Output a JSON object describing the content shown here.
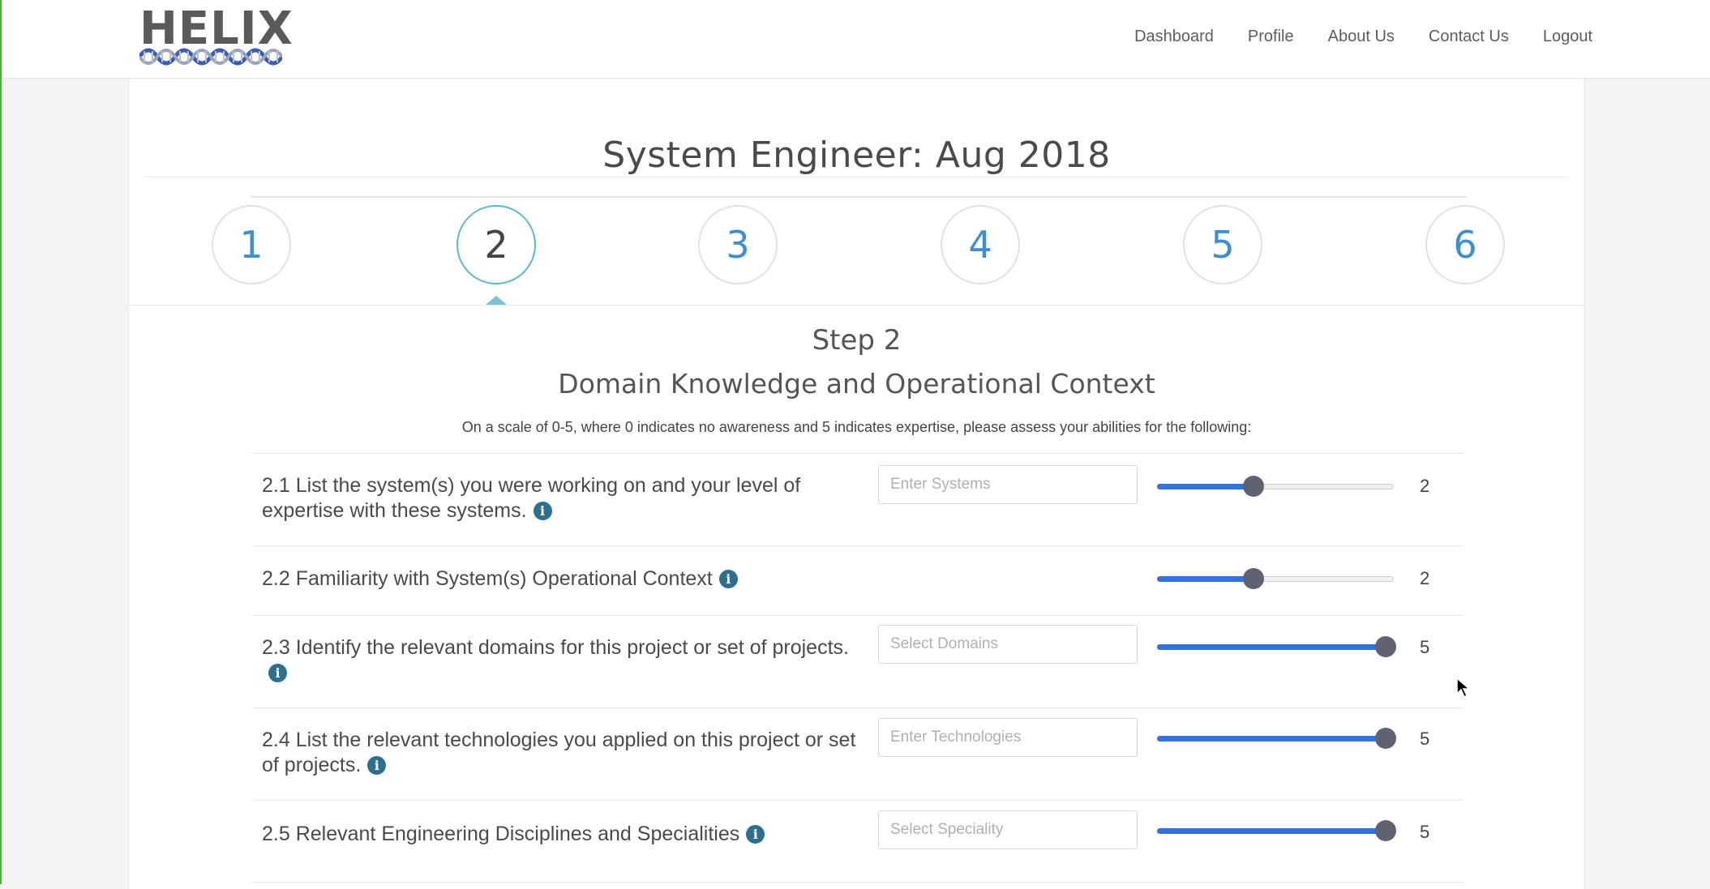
{
  "brand": {
    "logo_text": "HELIX"
  },
  "nav": {
    "items": [
      "Dashboard",
      "Profile",
      "About Us",
      "Contact Us",
      "Logout"
    ]
  },
  "page": {
    "title": "System Engineer: Aug 2018"
  },
  "stepper": {
    "steps": [
      "1",
      "2",
      "3",
      "4",
      "5",
      "6"
    ],
    "active_step": "2"
  },
  "step": {
    "label": "Step 2",
    "subtitle": "Domain Knowledge and Operational Context",
    "instructions": "On a scale of 0-5, where 0 indicates no awareness and 5 indicates expertise, please assess your abilities for the following:"
  },
  "questions": [
    {
      "text": "2.1 List the system(s) you were working on and your level of expertise with these systems.",
      "placeholder": "Enter Systems",
      "value": "2",
      "level": 0.4
    },
    {
      "text": "2.2 Familiarity with System(s) Operational Context",
      "placeholder": "",
      "value": "2",
      "level": 0.4
    },
    {
      "text": "2.3 Identify the relevant domains for this project or set of projects.",
      "placeholder": "Select Domains",
      "value": "5",
      "level": 1.0
    },
    {
      "text": "2.4 List the relevant technologies you applied on this project or set of projects.",
      "placeholder": "Enter Technologies",
      "value": "5",
      "level": 1.0
    },
    {
      "text": "2.5 Relevant Engineering Disciplines and Specialities",
      "placeholder": "Select Speciality",
      "value": "5",
      "level": 1.0
    }
  ],
  "colors": {
    "accent_blue": "#3e8ed0",
    "slider_fill": "#2f72e0",
    "active_step_border": "#5bb9c9",
    "info_icon": "#2f6f8e"
  }
}
